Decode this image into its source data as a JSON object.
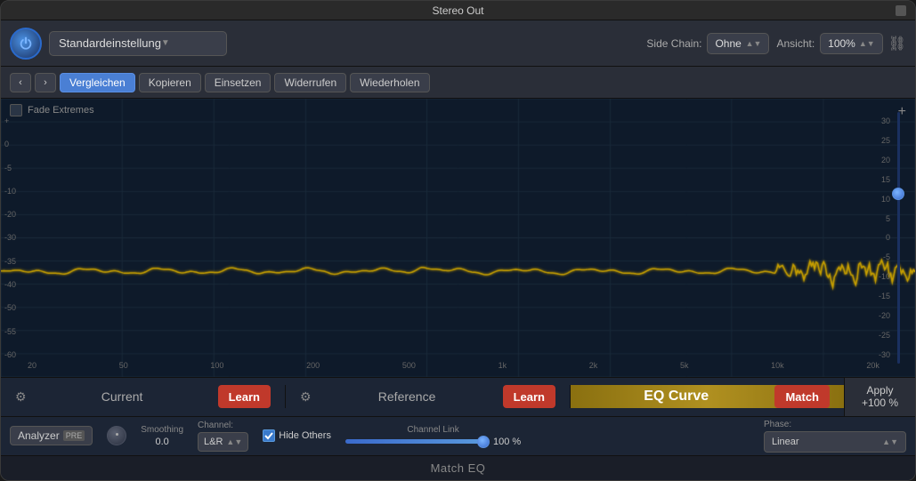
{
  "window": {
    "title": "Stereo Out",
    "footer_title": "Match EQ"
  },
  "toolbar": {
    "power_label": "⏻",
    "preset_value": "Standardeinstellung",
    "preset_arrow": "▼",
    "side_chain_label": "Side Chain:",
    "side_chain_value": "Ohne",
    "side_chain_arrow": "▲▼",
    "view_label": "Ansicht:",
    "view_value": "100%",
    "view_arrow": "▲▼"
  },
  "nav": {
    "back_label": "‹",
    "forward_label": "›",
    "compare_label": "Vergleichen",
    "copy_label": "Kopieren",
    "paste_label": "Einsetzen",
    "undo_label": "Widerrufen",
    "redo_label": "Wiederholen"
  },
  "eq_display": {
    "fade_extremes_label": "Fade Extremes",
    "db_left": [
      "+",
      "0",
      "-5",
      "-10",
      "-20",
      "-30",
      "-35",
      "-40",
      "-50",
      "-55",
      "-60"
    ],
    "db_right": [
      "30",
      "25",
      "20",
      "15",
      "10",
      "5",
      "0",
      "-5",
      "-10",
      "-15",
      "-20",
      "-25",
      "-30"
    ],
    "freq_labels": [
      "20",
      "50",
      "100",
      "200",
      "500",
      "1k",
      "2k",
      "5k",
      "10k",
      "20k"
    ]
  },
  "sections": {
    "current_label": "Current",
    "current_learn_label": "Learn",
    "reference_label": "Reference",
    "reference_learn_label": "Learn",
    "eq_curve_label": "EQ Curve",
    "match_label": "Match",
    "apply_label": "Apply",
    "apply_value": "+100 %"
  },
  "params": {
    "analyzer_label": "Analyzer",
    "pre_label": "PRE",
    "smoothing_label": "Smoothing",
    "smoothing_value": "0.0",
    "channel_label": "Channel:",
    "channel_value": "L&R",
    "channel_arrow": "▲▼",
    "hide_others_label": "Hide Others",
    "channel_link_label": "Channel Link",
    "channel_link_value": "100 %",
    "phase_label": "Phase:",
    "phase_value": "Linear",
    "phase_arrow": "▲▼"
  },
  "colors": {
    "active_btn": "#4a7fd4",
    "learn_btn": "#c0392b",
    "match_btn": "#c0392b",
    "eq_curve_bg": "#8a7010",
    "accent": "#d4a010"
  }
}
